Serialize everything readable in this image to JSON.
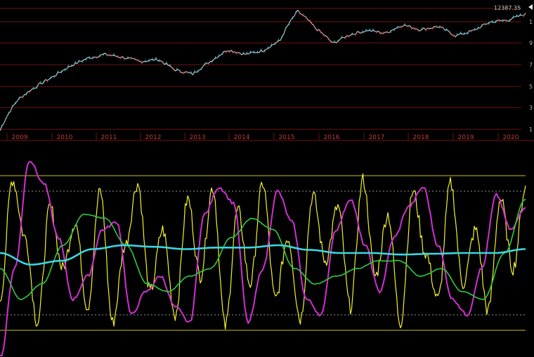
{
  "chart_data": [
    {
      "type": "line",
      "panel": "price",
      "last_price_label": "12387.35",
      "yticks": [
        "1",
        "9",
        "7",
        "5",
        "3",
        "1"
      ],
      "xticks": [
        "2009",
        "2010",
        "2011",
        "2012",
        "2013",
        "2014",
        "2015",
        "2016",
        "2017",
        "2018",
        "2019",
        "2020"
      ],
      "log_scale": true,
      "grid": true,
      "colors": {
        "line": "#d9d9d9",
        "up_candle": "#2ec7d8",
        "down_candle": "#d23b3b",
        "gridline": "#6e1414",
        "axis_text": "#c23b3b"
      },
      "series": [
        {
          "values": [
            1.0,
            1.9,
            2.5,
            3.1,
            3.9,
            4.6,
            5.0,
            4.7,
            4.3,
            4.5,
            3.6,
            3.3,
            4.3,
            5.5,
            5.0,
            5.4,
            6.7,
            12.4,
            8.7,
            6.3,
            7.6,
            8.3,
            7.8,
            9.3,
            8.4,
            9.0,
            7.4,
            8.2,
            9.9,
            10.3,
            11.7
          ]
        }
      ]
    },
    {
      "type": "line",
      "panel": "oscillators",
      "grid": false,
      "reference_levels": [
        1.0,
        0.8,
        -0.8,
        -1.0
      ],
      "colors": {
        "band": "#c9c41f",
        "dotted": "#9a9a9a",
        "fast": "#f2f22c",
        "medium": "#d030d0",
        "slow": "#2ecc40",
        "long": "#39d7e2"
      },
      "series": [
        {
          "values": [
            -0.6,
            0.95,
            0.2,
            -0.9,
            0.6,
            -0.2,
            0.4,
            -0.7,
            0.8,
            -0.9,
            0.1,
            0.9,
            -0.5,
            0.3,
            -0.8,
            0.7,
            -0.3,
            0.85,
            -0.95,
            0.55,
            -0.4,
            0.9,
            -0.6,
            0.2,
            -0.85,
            0.75,
            -0.1,
            0.6,
            -0.7,
            0.95,
            -0.3,
            0.5,
            -0.9,
            0.8,
            0.0,
            -0.6,
            0.9,
            -0.4,
            0.3,
            -0.75,
            0.7,
            -0.2,
            0.85
          ]
        },
        {
          "values": [
            -1.4,
            -0.2,
            1.2,
            0.9,
            0.2,
            -0.6,
            -0.3,
            0.3,
            0.4,
            -0.8,
            -0.5,
            -0.3,
            -0.7,
            -0.9,
            0.5,
            0.85,
            0.65,
            -0.9,
            -0.2,
            0.8,
            0.4,
            -0.6,
            -0.8,
            0.3,
            0.7,
            0.1,
            -0.5,
            0.2,
            0.6,
            0.85,
            0.1,
            -0.6,
            -0.8,
            -0.2,
            0.75,
            0.3,
            0.6
          ]
        },
        {
          "values": [
            -0.2,
            -0.6,
            -0.4,
            0.1,
            0.5,
            0.45,
            0.1,
            -0.4,
            -0.5,
            -0.3,
            -0.2,
            0.2,
            0.45,
            0.3,
            -0.2,
            -0.4,
            -0.3,
            -0.2,
            -0.1,
            -0.1,
            -0.3,
            -0.2,
            -0.5,
            -0.6,
            0.0,
            0.7
          ]
        },
        {
          "values": [
            0.0,
            -0.15,
            -0.1,
            0.05,
            0.1,
            0.08,
            0.05,
            0.07,
            0.07,
            0.1,
            0.04,
            0.0,
            0.0,
            -0.02,
            -0.01,
            0.0,
            0.0,
            0.05
          ]
        }
      ]
    }
  ]
}
